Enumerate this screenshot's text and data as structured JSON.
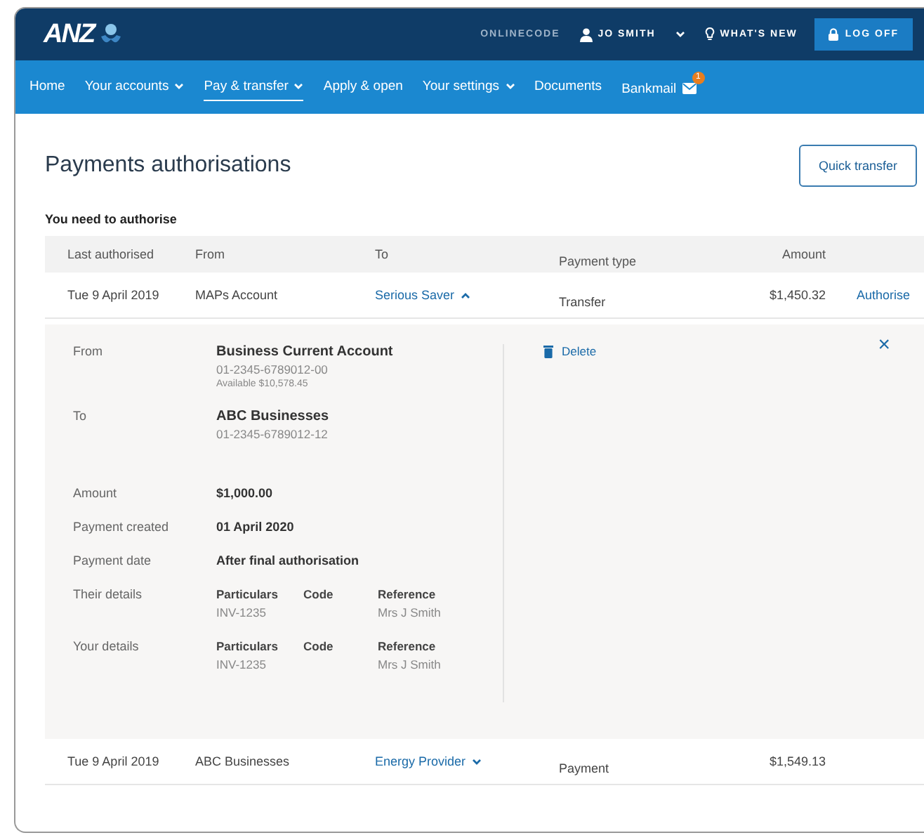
{
  "header": {
    "logo": "ANZ",
    "onlinecode": "ONLINECODE",
    "user": "JO SMITH",
    "whats_new": "WHAT'S NEW",
    "log_off": "LOG OFF"
  },
  "nav": [
    {
      "label": "Home",
      "dropdown": false,
      "selected": false
    },
    {
      "label": "Your accounts",
      "dropdown": true,
      "selected": false
    },
    {
      "label": "Pay & transfer",
      "dropdown": true,
      "selected": true
    },
    {
      "label": "Apply & open",
      "dropdown": false,
      "selected": false
    },
    {
      "label": "Your settings",
      "dropdown": true,
      "selected": false
    },
    {
      "label": "Documents",
      "dropdown": false,
      "selected": false
    },
    {
      "label": "Bankmail",
      "dropdown": false,
      "selected": false,
      "badge": "1"
    }
  ],
  "page_title": "Payments authorisations",
  "quick_transfer": "Quick transfer",
  "section_title": "You need to authorise",
  "table": {
    "columns": [
      "Last authorised",
      "From",
      "To",
      "Payment type",
      "Amount"
    ],
    "rows": [
      {
        "last_authorised": "Tue 9 April 2019",
        "from": "MAPs Account",
        "to": "Serious Saver",
        "payment_type": "Transfer",
        "amount": "$1,450.32",
        "action": "Authorise",
        "expanded": true,
        "detail": {
          "from": {
            "label": "From",
            "name": "Business Current Account",
            "account": "01-2345-6789012-00",
            "available": "Available $10,578.45"
          },
          "to": {
            "label": "To",
            "name": "ABC Businesses",
            "account": "01-2345-6789012-12"
          },
          "fields": [
            {
              "label": "Amount",
              "value": "$1,000.00"
            },
            {
              "label": "Payment created",
              "value": "01 April 2020"
            },
            {
              "label": "Payment date",
              "value": "After final authorisation"
            }
          ],
          "details": [
            {
              "label": "Their details",
              "particulars_label": "Particulars",
              "particulars": "INV-1235",
              "code_label": "Code",
              "reference_label": "Reference",
              "reference": "Mrs J Smith"
            },
            {
              "label": "Your details",
              "particulars_label": "Particulars",
              "particulars": "INV-1235",
              "code_label": "Code",
              "reference_label": "Reference",
              "reference": "Mrs J Smith"
            }
          ],
          "delete": "Delete",
          "close": "×"
        }
      },
      {
        "last_authorised": "Tue 9 April 2019",
        "from": "ABC Businesses",
        "to": "Energy Provider",
        "payment_type": "Payment",
        "amount": "$1,549.13",
        "expanded": false
      }
    ]
  }
}
